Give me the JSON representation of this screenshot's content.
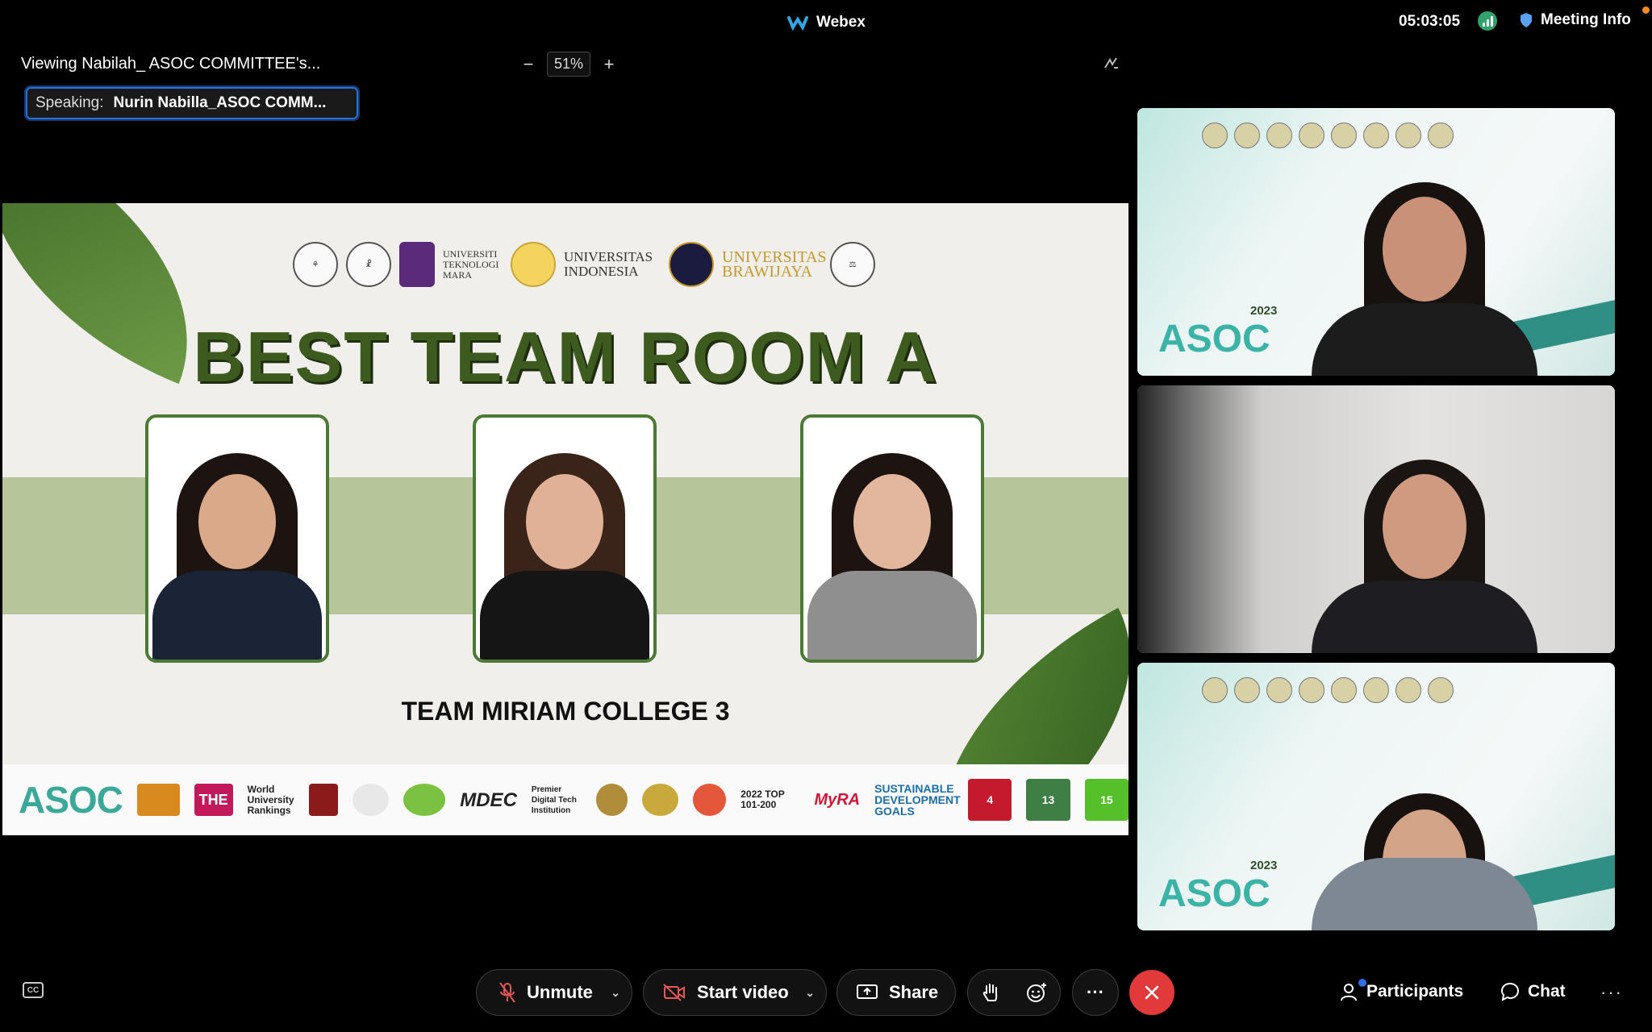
{
  "app": {
    "title": "Webex",
    "clock": "05:03:05",
    "meeting_info_label": "Meeting Info"
  },
  "share": {
    "viewing_label": "Viewing Nabilah_ ASOC COMMITTEE's...",
    "zoom_minus": "−",
    "zoom_value": "51%",
    "zoom_plus": "+",
    "speaking_label": "Speaking:",
    "speaking_name": "Nurin Nabilla_ASOC COMM..."
  },
  "slide": {
    "title": "BEST TEAM ROOM A",
    "team_name": "TEAM MIRIAM COLLEGE 3",
    "header_logos": {
      "uitm": "UNIVERSITI TEKNOLOGI MARA",
      "ui": "UNIVERSITAS INDONESIA",
      "ub": "UNIVERSITAS BRAWIJAYA"
    },
    "footer": {
      "asoc": "ASOC",
      "the": "THE",
      "the_text": "World University Rankings",
      "mdec": "MDEC",
      "mdec_text": "Premier Digital Tech Institution",
      "impact": "2022 TOP 101-200",
      "myra": "MyRA",
      "sdg": "SUSTAINABLE DEVELOPMENT GOALS",
      "sdg4": "4",
      "sdg13": "13",
      "sdg15": "15"
    }
  },
  "tiles": [
    {
      "year": "2023",
      "tag": "ASOC"
    },
    {
      "year": "",
      "tag": ""
    },
    {
      "year": "2023",
      "tag": "ASOC"
    }
  ],
  "controls": {
    "cc": "CC",
    "unmute": "Unmute",
    "start_video": "Start video",
    "share": "Share",
    "more": "···",
    "participants": "Participants",
    "chat": "Chat",
    "overflow": "···"
  },
  "colors": {
    "leave": "#e23a3a",
    "accent_blue": "#2a6fd6",
    "slide_green": "#3d5a1f"
  }
}
